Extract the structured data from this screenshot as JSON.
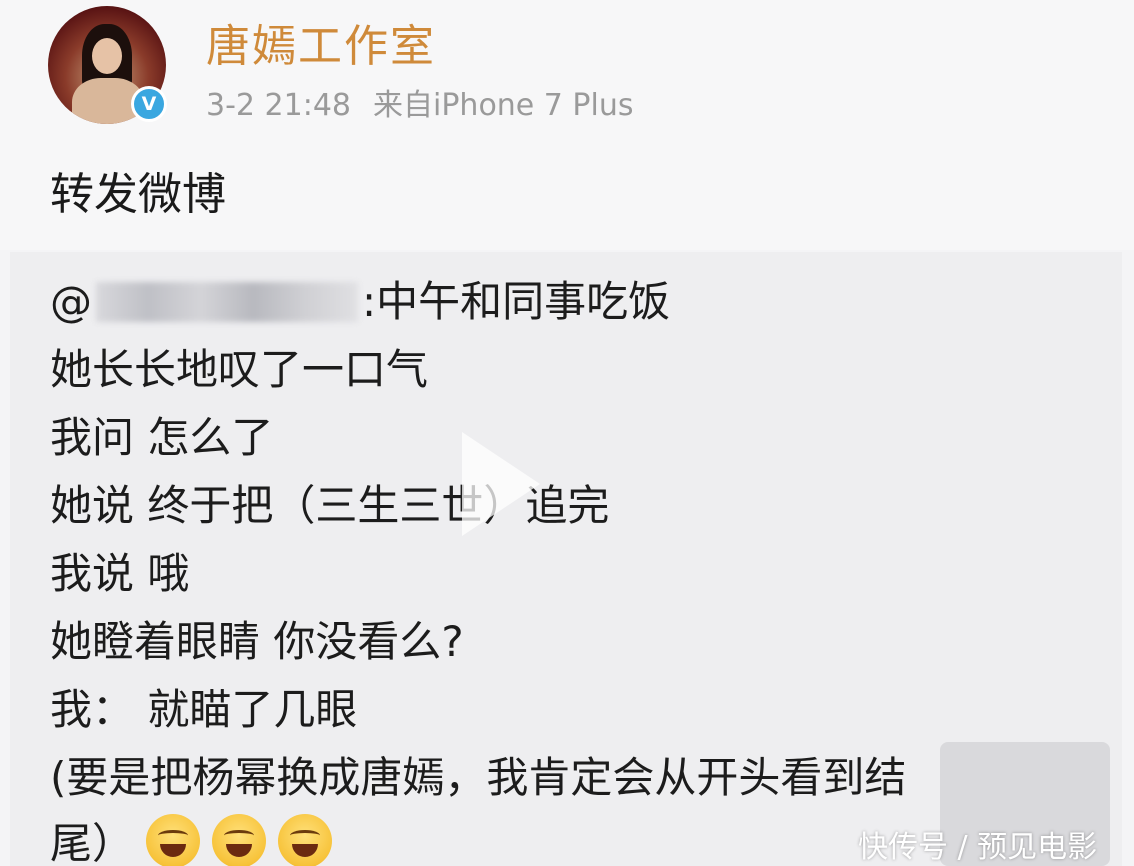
{
  "post": {
    "username": "唐嫣工作室",
    "timestamp": "3-2 21:48",
    "source": "来自iPhone 7 Plus",
    "text": "转发微博",
    "verified_badge": "V"
  },
  "quoted": {
    "mention_prefix": "@",
    "mention_suffix": ":中午和同事吃饭",
    "lines": [
      "她长长地叹了一口气",
      "我问 怎么了",
      "她说 终于把（三生三世）追完",
      "我说 哦",
      "她瞪着眼睛 你没看么?",
      "我：  就瞄了几眼",
      "(要是把杨幂换成唐嫣，我肯定会从开头看到结",
      "尾）"
    ],
    "emoji_icon": "laughing-tears-emoji"
  },
  "watermark": "快传号 / 预见电影",
  "colors": {
    "username": "#cf8a3a",
    "meta": "#9a9a9a",
    "verified": "#3aa7e0",
    "quote_bg": "#eeeef0"
  }
}
